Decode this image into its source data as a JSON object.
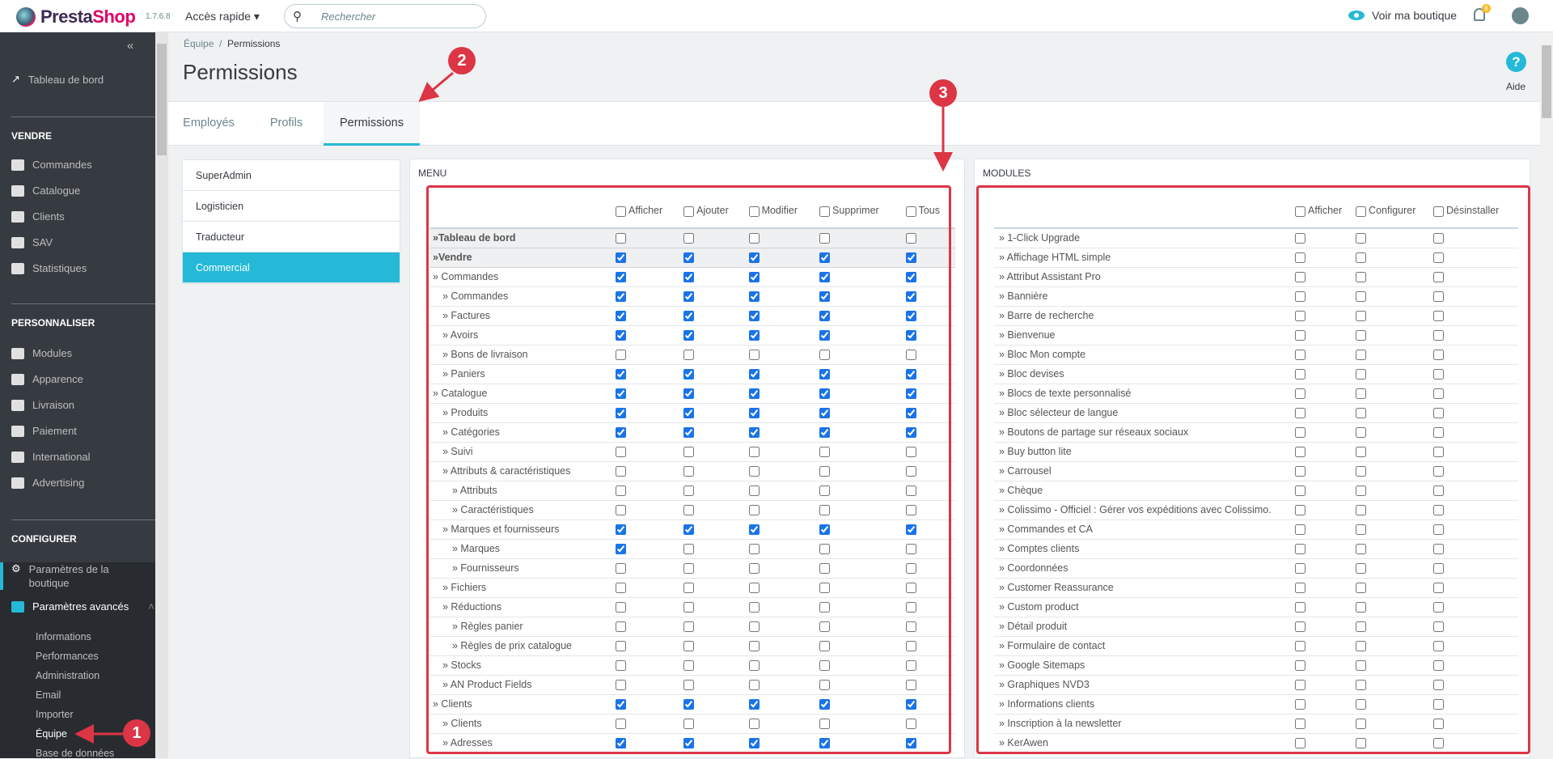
{
  "topbar": {
    "brand_a": "Presta",
    "brand_b": "Shop",
    "version": "1.7.6.8",
    "quick_access": "Accès rapide ▾",
    "search_placeholder": "Rechercher",
    "view_shop": "Voir ma boutique",
    "notifications": "8"
  },
  "sidebar": {
    "collapse": "«",
    "dashboard": "Tableau de bord",
    "sell": {
      "title": "VENDRE",
      "items": [
        "Commandes",
        "Catalogue",
        "Clients",
        "SAV",
        "Statistiques"
      ]
    },
    "customize": {
      "title": "PERSONNALISER",
      "items": [
        "Modules",
        "Apparence",
        "Livraison",
        "Paiement",
        "International",
        "Advertising"
      ]
    },
    "configure": {
      "title": "CONFIGURER",
      "shop_params": "Paramètres de la boutique",
      "advanced": "Paramètres avancés",
      "sub": [
        "Informations",
        "Performances",
        "Administration",
        "Email",
        "Importer",
        "Équipe",
        "Base de données"
      ],
      "active_sub": "Équipe"
    }
  },
  "breadcrumb": {
    "parent": "Équipe",
    "current": "Permissions"
  },
  "page_title": "Permissions",
  "help": "Aide",
  "tabs": [
    "Employés",
    "Profils",
    "Permissions"
  ],
  "active_tab": "Permissions",
  "profiles": [
    "SuperAdmin",
    "Logisticien",
    "Traducteur",
    "Commercial"
  ],
  "active_profile": "Commercial",
  "menu": {
    "title": "MENU",
    "columns": [
      "Afficher",
      "Ajouter",
      "Modifier",
      "Supprimer",
      "Tous"
    ],
    "rows": [
      {
        "label": "»Tableau de bord",
        "level": 0,
        "checks": "00000"
      },
      {
        "label": "»Vendre",
        "level": 0,
        "checks": "11111"
      },
      {
        "label": "» Commandes",
        "level": 1,
        "checks": "11111"
      },
      {
        "label": "» Commandes",
        "level": 2,
        "checks": "11111"
      },
      {
        "label": "» Factures",
        "level": 2,
        "checks": "11111"
      },
      {
        "label": "» Avoirs",
        "level": 2,
        "checks": "11111"
      },
      {
        "label": "» Bons de livraison",
        "level": 2,
        "checks": "00000"
      },
      {
        "label": "» Paniers",
        "level": 2,
        "checks": "11111"
      },
      {
        "label": "» Catalogue",
        "level": 1,
        "checks": "11111"
      },
      {
        "label": "» Produits",
        "level": 2,
        "checks": "11111"
      },
      {
        "label": "» Catégories",
        "level": 2,
        "checks": "11111"
      },
      {
        "label": "» Suivi",
        "level": 2,
        "checks": "00000"
      },
      {
        "label": "» Attributs & caractéristiques",
        "level": 2,
        "checks": "00000"
      },
      {
        "label": "» Attributs",
        "level": 3,
        "checks": "00000"
      },
      {
        "label": "» Caractéristiques",
        "level": 3,
        "checks": "00000"
      },
      {
        "label": "» Marques et fournisseurs",
        "level": 2,
        "checks": "11111"
      },
      {
        "label": "» Marques",
        "level": 3,
        "checks": "10000"
      },
      {
        "label": "» Fournisseurs",
        "level": 3,
        "checks": "00000"
      },
      {
        "label": "» Fichiers",
        "level": 2,
        "checks": "00000"
      },
      {
        "label": "» Réductions",
        "level": 2,
        "checks": "00000"
      },
      {
        "label": "» Règles panier",
        "level": 3,
        "checks": "00000"
      },
      {
        "label": "» Règles de prix catalogue",
        "level": 3,
        "checks": "00000"
      },
      {
        "label": "» Stocks",
        "level": 2,
        "checks": "00000"
      },
      {
        "label": "» AN Product Fields",
        "level": 2,
        "checks": "00000"
      },
      {
        "label": "» Clients",
        "level": 1,
        "checks": "11111"
      },
      {
        "label": "» Clients",
        "level": 2,
        "checks": "00000"
      },
      {
        "label": "» Adresses",
        "level": 2,
        "checks": "11111"
      }
    ]
  },
  "modules": {
    "title": "MODULES",
    "columns": [
      "Afficher",
      "Configurer",
      "Désinstaller"
    ],
    "rows": [
      "» 1-Click Upgrade",
      "» Affichage HTML simple",
      "» Attribut Assistant Pro",
      "» Bannière",
      "» Barre de recherche",
      "» Bienvenue",
      "» Bloc Mon compte",
      "» Bloc devises",
      "» Blocs de texte personnalisé",
      "» Bloc sélecteur de langue",
      "» Boutons de partage sur réseaux sociaux",
      "» Buy button lite",
      "» Carrousel",
      "» Chèque",
      "» Colissimo - Officiel : Gérer vos expéditions avec Colissimo.",
      "» Commandes et CA",
      "» Comptes clients",
      "» Coordonnées",
      "» Customer Reassurance",
      "» Custom product",
      "» Détail produit",
      "» Formulaire de contact",
      "» Google Sitemaps",
      "» Graphiques NVD3",
      "» Informations clients",
      "» Inscription à la newsletter",
      "» KerAwen"
    ]
  },
  "annotations": [
    "1",
    "2",
    "3"
  ],
  "colors": {
    "accent": "#25b9d7",
    "annotation": "#dc3545",
    "sidebar": "#363a41"
  }
}
